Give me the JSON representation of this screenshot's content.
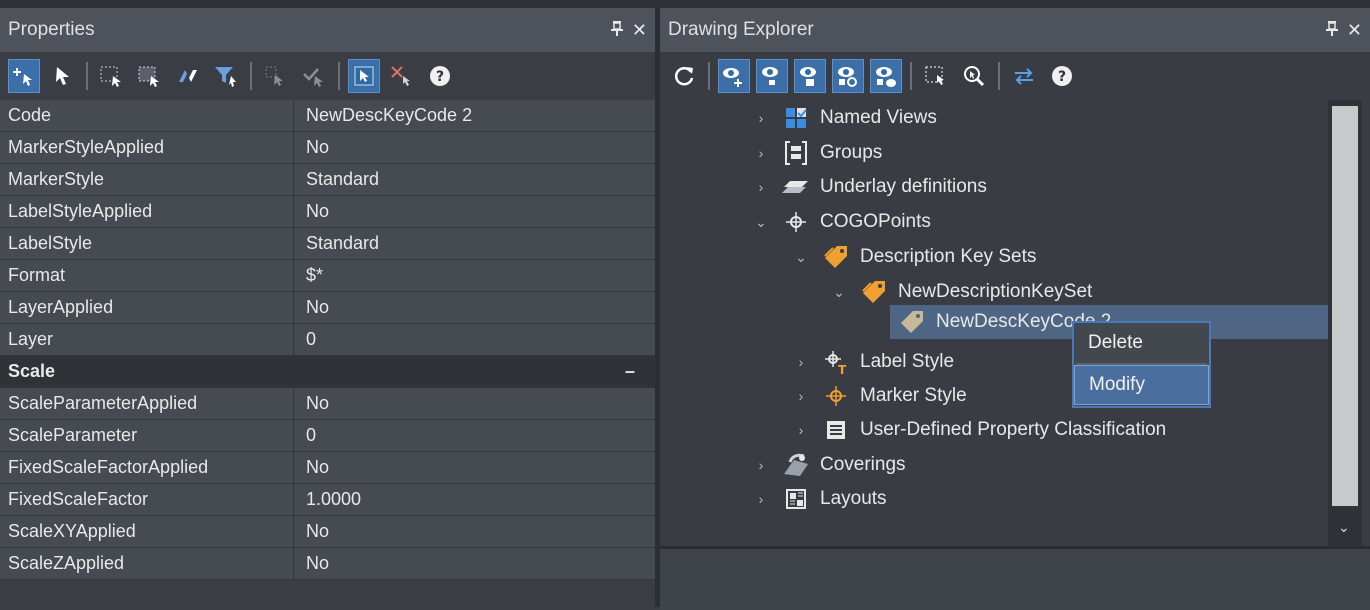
{
  "properties": {
    "title": "Properties",
    "pin_glyph": "ᵰ",
    "close_glyph": "✕",
    "rows": [
      {
        "key": "Code",
        "value": "NewDescKeyCode 2"
      },
      {
        "key": "MarkerStyleApplied",
        "value": "No"
      },
      {
        "key": "MarkerStyle",
        "value": "Standard"
      },
      {
        "key": "LabelStyleApplied",
        "value": "No"
      },
      {
        "key": "LabelStyle",
        "value": "Standard"
      },
      {
        "key": "Format",
        "value": "$*"
      },
      {
        "key": "LayerApplied",
        "value": "No"
      },
      {
        "key": "Layer",
        "value": "0"
      }
    ],
    "section_scale": {
      "label": "Scale",
      "toggle": "–"
    },
    "scale_rows": [
      {
        "key": "ScaleParameterApplied",
        "value": "No"
      },
      {
        "key": "ScaleParameter",
        "value": "0"
      },
      {
        "key": "FixedScaleFactorApplied",
        "value": "No"
      },
      {
        "key": "FixedScaleFactor",
        "value": "1.0000"
      },
      {
        "key": "ScaleXYApplied",
        "value": "No"
      },
      {
        "key": "ScaleZApplied",
        "value": "No"
      }
    ]
  },
  "explorer": {
    "title": "Drawing Explorer",
    "pin_glyph": "ᵰ",
    "close_glyph": "✕",
    "tree": {
      "named_views": "Named Views",
      "groups": "Groups",
      "underlay_definitions": "Underlay definitions",
      "cogo_points": "COGOPoints",
      "description_key_sets": "Description Key Sets",
      "new_description_key_set": "NewDescriptionKeySet",
      "new_desc_key_code": "NewDescKeyCode 2",
      "label_style": "Label Style",
      "marker_style": "Marker Style",
      "user_defined_property_classification": "User-Defined Property Classification",
      "coverings": "Coverings",
      "layouts": "Layouts"
    },
    "context_menu": {
      "delete": "Delete",
      "modify": "Modify"
    }
  },
  "colors": {
    "accent_blue": "#3c6ea8",
    "selection": "#4e6683",
    "orange_icon": "#f0a030"
  }
}
